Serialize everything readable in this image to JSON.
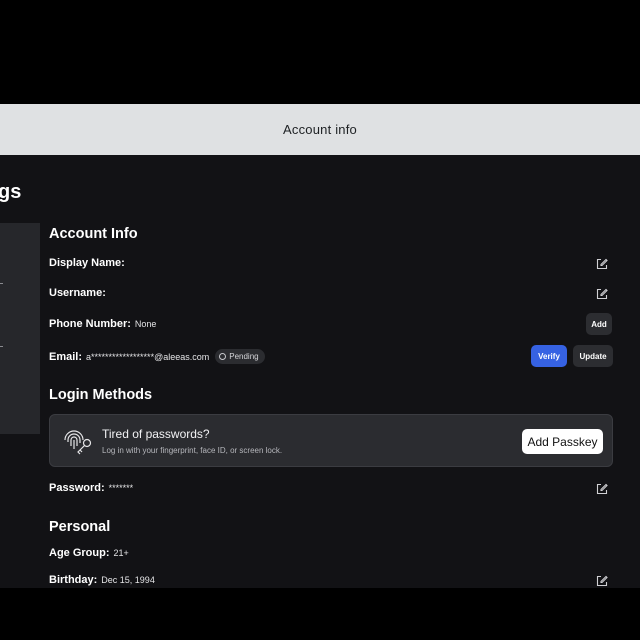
{
  "topbar": {
    "title": "Account info"
  },
  "page": {
    "title": "gs"
  },
  "account": {
    "heading": "Account Info",
    "display_name_label": "Display Name:",
    "username_label": "Username:",
    "phone_label": "Phone Number:",
    "phone_value": "None",
    "phone_add": "Add",
    "email_label": "Email:",
    "email_value": "a******************@aleeas.com",
    "email_status": "Pending",
    "verify": "Verify",
    "update": "Update"
  },
  "login": {
    "heading": "Login Methods",
    "banner_title": "Tired of passwords?",
    "banner_sub": "Log in with your fingerprint, face ID, or screen lock.",
    "add_passkey": "Add Passkey",
    "password_label": "Password:",
    "password_value": "*******"
  },
  "personal": {
    "heading": "Personal",
    "age_label": "Age Group:",
    "age_value": "21+",
    "birthday_label": "Birthday:",
    "birthday_value": "Dec 15, 1994"
  },
  "icons": {
    "edit": "edit-icon",
    "passkey": "fingerprint-key-icon",
    "pending": "clock-icon"
  },
  "colors": {
    "accent": "#3662e3",
    "background": "#121215",
    "topbar": "#dfe1e3"
  }
}
